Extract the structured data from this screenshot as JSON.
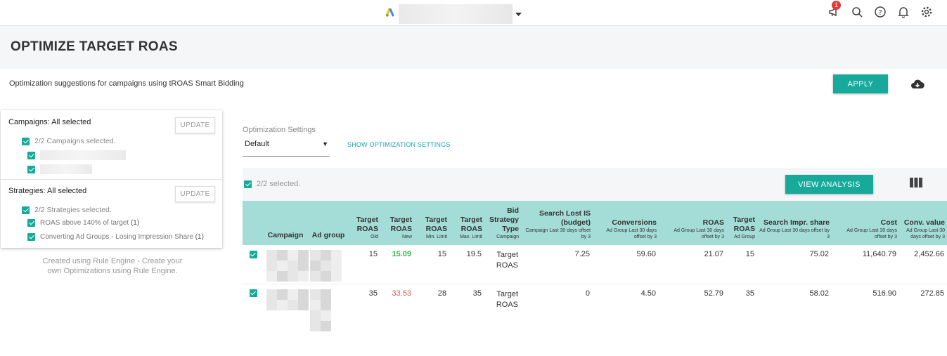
{
  "topbar": {
    "notification_count": "1"
  },
  "page": {
    "title": "OPTIMIZE TARGET ROAS",
    "subtitle": "Optimization suggestions for campaigns using tROAS Smart Bidding",
    "apply_label": "APPLY"
  },
  "campaigns": {
    "heading": "Campaigns: All selected",
    "update_label": "UPDATE",
    "summary": "2/2 Campaigns selected."
  },
  "strategies": {
    "heading": "Strategies: All selected",
    "update_label": "UPDATE",
    "summary": "2/2 Strategies selected.",
    "items": [
      {
        "label": "ROAS above 140% of target",
        "count": "(1)"
      },
      {
        "label": "Converting Ad Groups - Losing Impression Share",
        "count": "(1)"
      }
    ]
  },
  "footnote": "Created using Rule Engine - Create your own Optimizations using Rule Engine.",
  "optimization": {
    "label": "Optimization Settings",
    "selected": "Default",
    "show_link": "SHOW OPTIMIZATION SETTINGS"
  },
  "selection": {
    "text": "2/2 selected.",
    "view_analysis_label": "VIEW ANALYSIS"
  },
  "table": {
    "headers": [
      {
        "label": "Campaign",
        "sub": ""
      },
      {
        "label": "Ad group",
        "sub": ""
      },
      {
        "label": "Target ROAS",
        "sub": "Old"
      },
      {
        "label": "Target ROAS",
        "sub": "New"
      },
      {
        "label": "Target ROAS",
        "sub": "Min. Limit"
      },
      {
        "label": "Target ROAS",
        "sub": "Max. Limit"
      },
      {
        "label": "Bid Strategy Type",
        "sub": "Campaign"
      },
      {
        "label": "Search Lost IS (budget)",
        "sub": "Campaign Last 30 days offset by 3"
      },
      {
        "label": "Conversions",
        "sub": "Ad Group Last 30 days offset by 3"
      },
      {
        "label": "ROAS",
        "sub": "Ad Group Last 30 days offset by 3"
      },
      {
        "label": "Target ROAS",
        "sub": "Ad Group"
      },
      {
        "label": "Search Impr. share",
        "sub": "Ad Group Last 30 days offset by 3"
      },
      {
        "label": "Cost",
        "sub": "Ad Group Last 30 days offset by 3"
      },
      {
        "label": "Conv. value",
        "sub": "Ad Group Last 30 days offset by 3"
      }
    ],
    "rows": [
      {
        "old": "15",
        "new": "15.09",
        "min": "15",
        "max": "19.5",
        "bid": "Target ROAS",
        "lost": "7.25",
        "conv": "59.60",
        "roas": "21.07",
        "target": "15",
        "impr": "75.02",
        "cost": "11,640.79",
        "convval": "2,452.66"
      },
      {
        "old": "35",
        "new": "33.53",
        "min": "28",
        "max": "35",
        "bid": "Target ROAS",
        "lost": "0",
        "conv": "4.50",
        "roas": "52.79",
        "target": "35",
        "impr": "58.02",
        "cost": "516.90",
        "convval": "272.85"
      }
    ]
  }
}
